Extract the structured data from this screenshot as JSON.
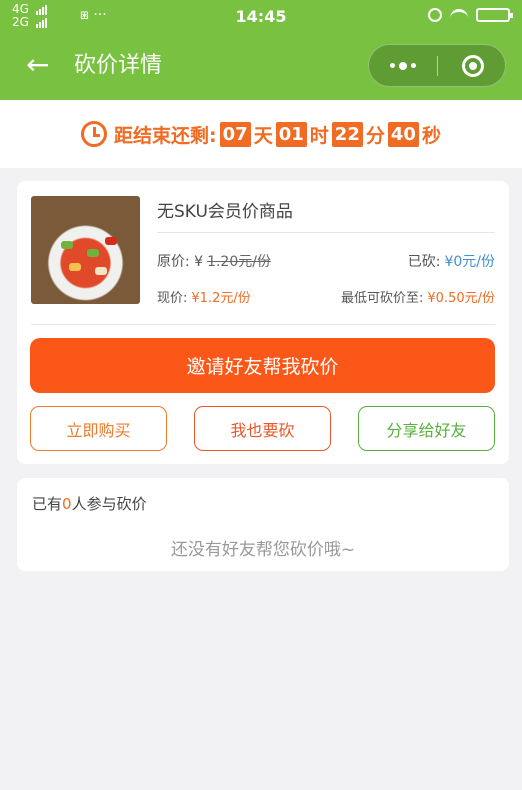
{
  "status_bar": {
    "network1": "4G",
    "network2": "2G",
    "misc": "⧆ ···",
    "time": "14:45"
  },
  "nav": {
    "back_icon": "←",
    "title": "砍价详情"
  },
  "countdown": {
    "prefix": "距结束还剩:",
    "days": "07",
    "day_unit": "天",
    "hours": "01",
    "hour_unit": "时",
    "minutes": "22",
    "minute_unit": "分",
    "seconds": "40",
    "second_unit": "秒"
  },
  "product": {
    "name": "无SKU会员价商品",
    "original_price_label": "原价: ¥",
    "original_price": "1.20元/份",
    "cut_label": "已砍:",
    "cut_value": "¥0元/份",
    "current_price_label": "现价:",
    "current_price": "¥1.2元/份",
    "min_price_label": "最低可砍价至:",
    "min_price": "¥0.50元/份"
  },
  "actions": {
    "invite": "邀请好友帮我砍价",
    "buy_now": "立即购买",
    "me_too": "我也要砍",
    "share": "分享给好友"
  },
  "participants": {
    "prefix": "已有",
    "count": "0",
    "suffix": "人参与砍价",
    "empty_message": "还没有好友帮您砍价哦~"
  },
  "icons": {
    "back": "back-arrow-icon",
    "more": "more-dots-icon",
    "close": "capsule-close-icon",
    "alarm": "alarm-clock-icon"
  },
  "colors": {
    "nav_green": "#79c141",
    "accent_orange": "#fb5718",
    "countdown_orange": "#f06b23",
    "price_blue": "#3f8fd6",
    "share_green": "#5aaf3c"
  }
}
